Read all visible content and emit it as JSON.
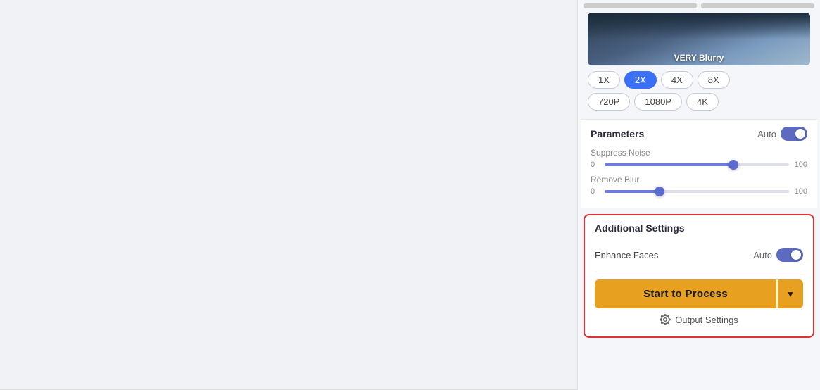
{
  "thumbnail": {
    "label": "VERY Blurry"
  },
  "scale": {
    "options": [
      "1X",
      "2X",
      "4X",
      "8X"
    ],
    "active": "2X",
    "resolution_options": [
      "720P",
      "1080P",
      "4K"
    ]
  },
  "parameters": {
    "title": "Parameters",
    "auto_label": "Auto",
    "suppress_noise": {
      "label": "Suppress Noise",
      "min": "0",
      "max": "100",
      "value": 70
    },
    "remove_blur": {
      "label": "Remove Blur",
      "min": "0",
      "max": "100",
      "value": 30
    }
  },
  "additional_settings": {
    "title": "Additional Settings",
    "enhance_faces": {
      "label": "Enhance Faces",
      "auto_label": "Auto"
    }
  },
  "process_button": {
    "label": "Start to Process"
  },
  "output_settings": {
    "label": "Output Settings"
  }
}
